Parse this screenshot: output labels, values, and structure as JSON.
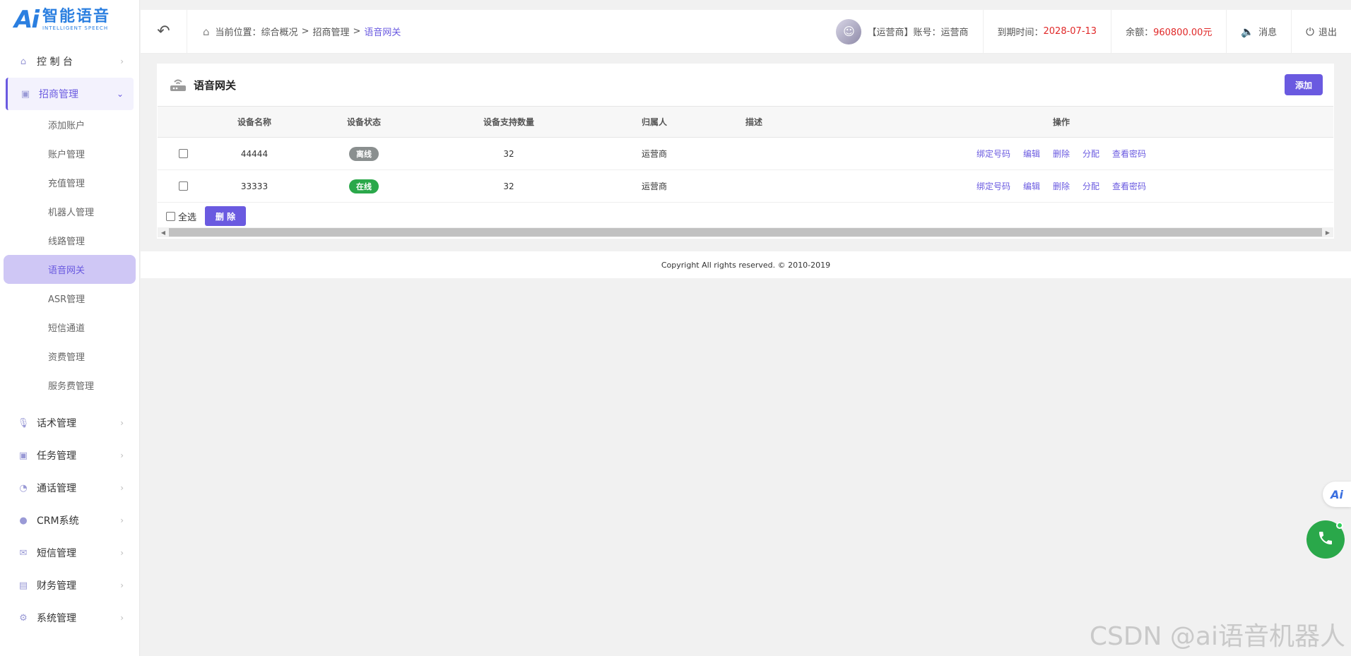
{
  "brand": {
    "mark": "Ai",
    "name_cn": "智能语音",
    "name_en": "INTELLIGENT SPEECH"
  },
  "sidebar": {
    "dashboard": "控 制 台",
    "recruit": "招商管理",
    "sub_items": [
      "添加账户",
      "账户管理",
      "充值管理",
      "机器人管理",
      "线路管理",
      "语音网关",
      "ASR管理",
      "短信通道",
      "资费管理",
      "服务费管理"
    ],
    "groups": [
      "话术管理",
      "任务管理",
      "通话管理",
      "CRM系统",
      "短信管理",
      "财务管理",
      "系统管理"
    ]
  },
  "header": {
    "breadcrumb_label": "当前位置：",
    "crumb1": "综合概况",
    "crumb2": "招商管理",
    "crumb3": "语音网关",
    "sep": ">",
    "account": "【运营商】账号：运营商",
    "expire_label": "到期时间：",
    "expire_value": "2028-07-13",
    "balance_label": "余额：",
    "balance_value": "960800.00元",
    "message": "消息",
    "logout": "退出"
  },
  "panel": {
    "title": "语音网关",
    "add_label": "添加",
    "columns": [
      "设备名称",
      "设备状态",
      "设备支持数量",
      "归属人",
      "描述",
      "操作"
    ],
    "rows": [
      {
        "name": "44444",
        "status": "离线",
        "status_kind": "offline",
        "capacity": "32",
        "owner": "运营商",
        "desc": ""
      },
      {
        "name": "33333",
        "status": "在线",
        "status_kind": "online",
        "capacity": "32",
        "owner": "运营商",
        "desc": ""
      }
    ],
    "ops": [
      "绑定号码",
      "编辑",
      "删除",
      "分配",
      "查看密码"
    ],
    "select_all": "全选",
    "delete_label": "删 除"
  },
  "footer": {
    "copyright": "Copyright All rights reserved. © 2010-2019"
  },
  "float": {
    "ai_label": "Ai"
  },
  "watermark": "CSDN @ai语音机器人",
  "colors": {
    "accent": "#6a5ae0",
    "online": "#2aa84a",
    "offline": "#8a8f8f",
    "alert": "#e02828"
  }
}
